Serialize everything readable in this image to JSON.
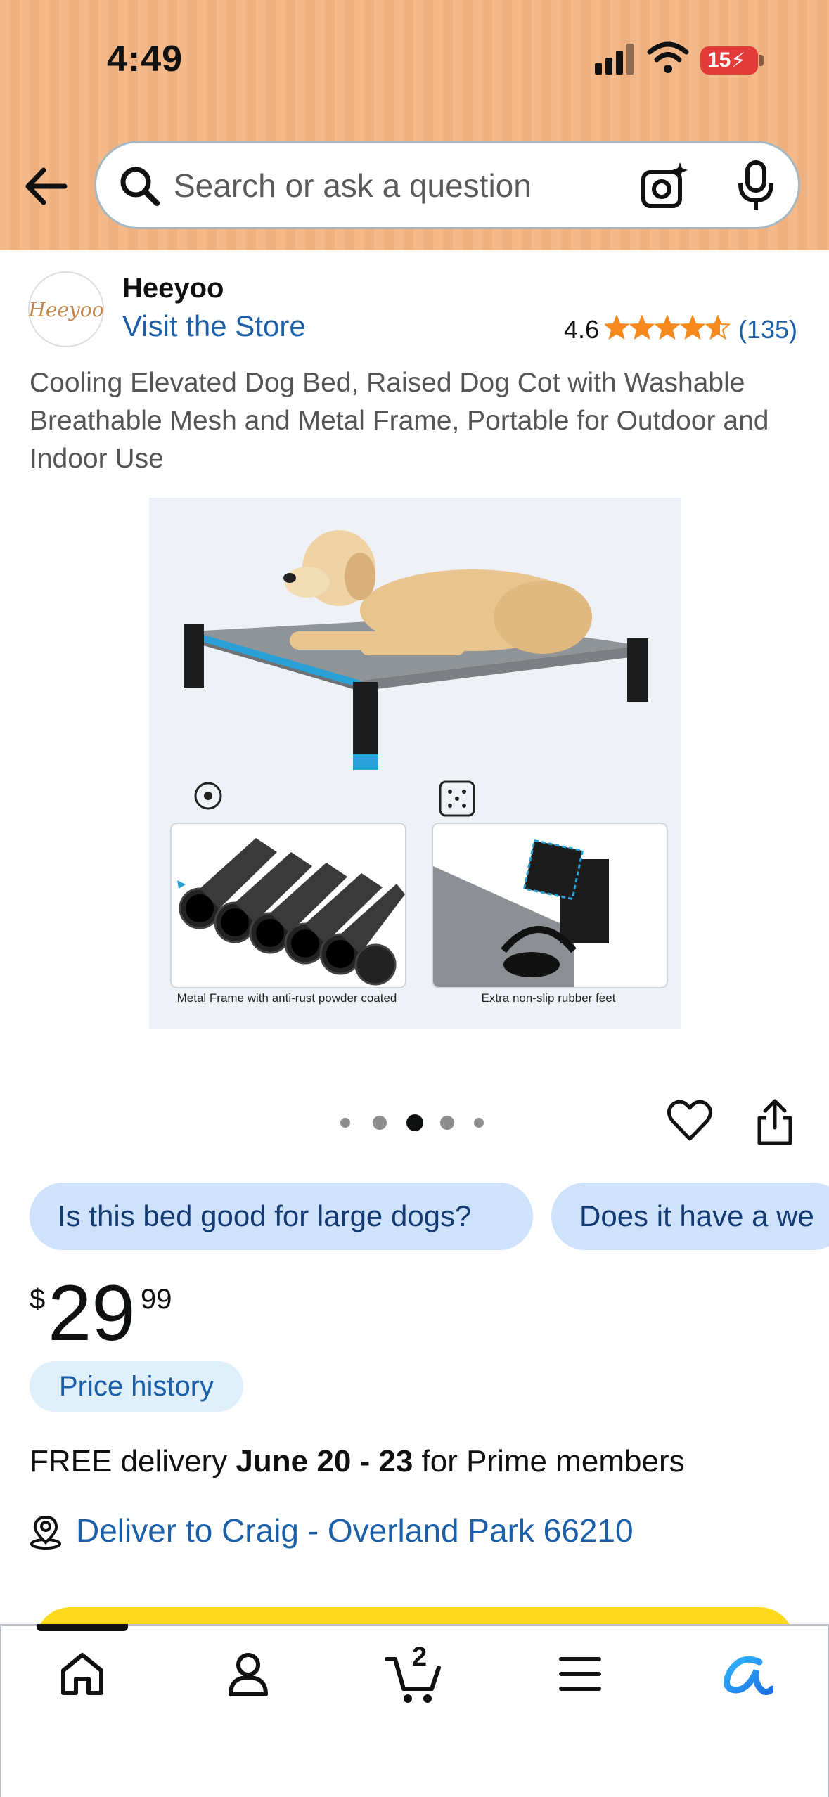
{
  "status_bar": {
    "time": "4:49",
    "battery": "15"
  },
  "search": {
    "placeholder": "Search or ask a question"
  },
  "brand": {
    "name": "Heeyoo",
    "logo_text": "Heeyoo",
    "store_link": "Visit the Store"
  },
  "rating": {
    "value": "4.6",
    "stars": 4.6,
    "count": "(135)"
  },
  "product": {
    "title": "Cooling Elevated Dog Bed, Raised Dog Cot with Washable Breathable Mesh and Metal Frame, Portable for Outdoor and Indoor Use",
    "image_captions": [
      "Metal Frame with anti-rust powder coated",
      "Extra non-slip rubber feet"
    ],
    "carousel": {
      "total": 5,
      "active_index": 2
    }
  },
  "suggestions": [
    "Is this bed good for large dogs?",
    "Does it have a we"
  ],
  "price": {
    "symbol": "$",
    "whole": "29",
    "fraction": "99",
    "history_label": "Price history"
  },
  "delivery": {
    "prefix": "FREE delivery ",
    "dates": "June 20 - 23",
    "suffix": " for Prime members"
  },
  "location": {
    "text": "Deliver to Craig - Overland Park 66210"
  },
  "nav": {
    "cart_count": "2",
    "items": [
      "home-icon",
      "account-icon",
      "cart-icon",
      "menu-icon",
      "rufus-icon"
    ]
  },
  "colors": {
    "header": "#f3b98a",
    "link": "#1a5fa8",
    "star": "#f68a1e",
    "chip": "#cfe2fb",
    "buy_button": "#fdd81b",
    "battery": "#e33a3a"
  }
}
